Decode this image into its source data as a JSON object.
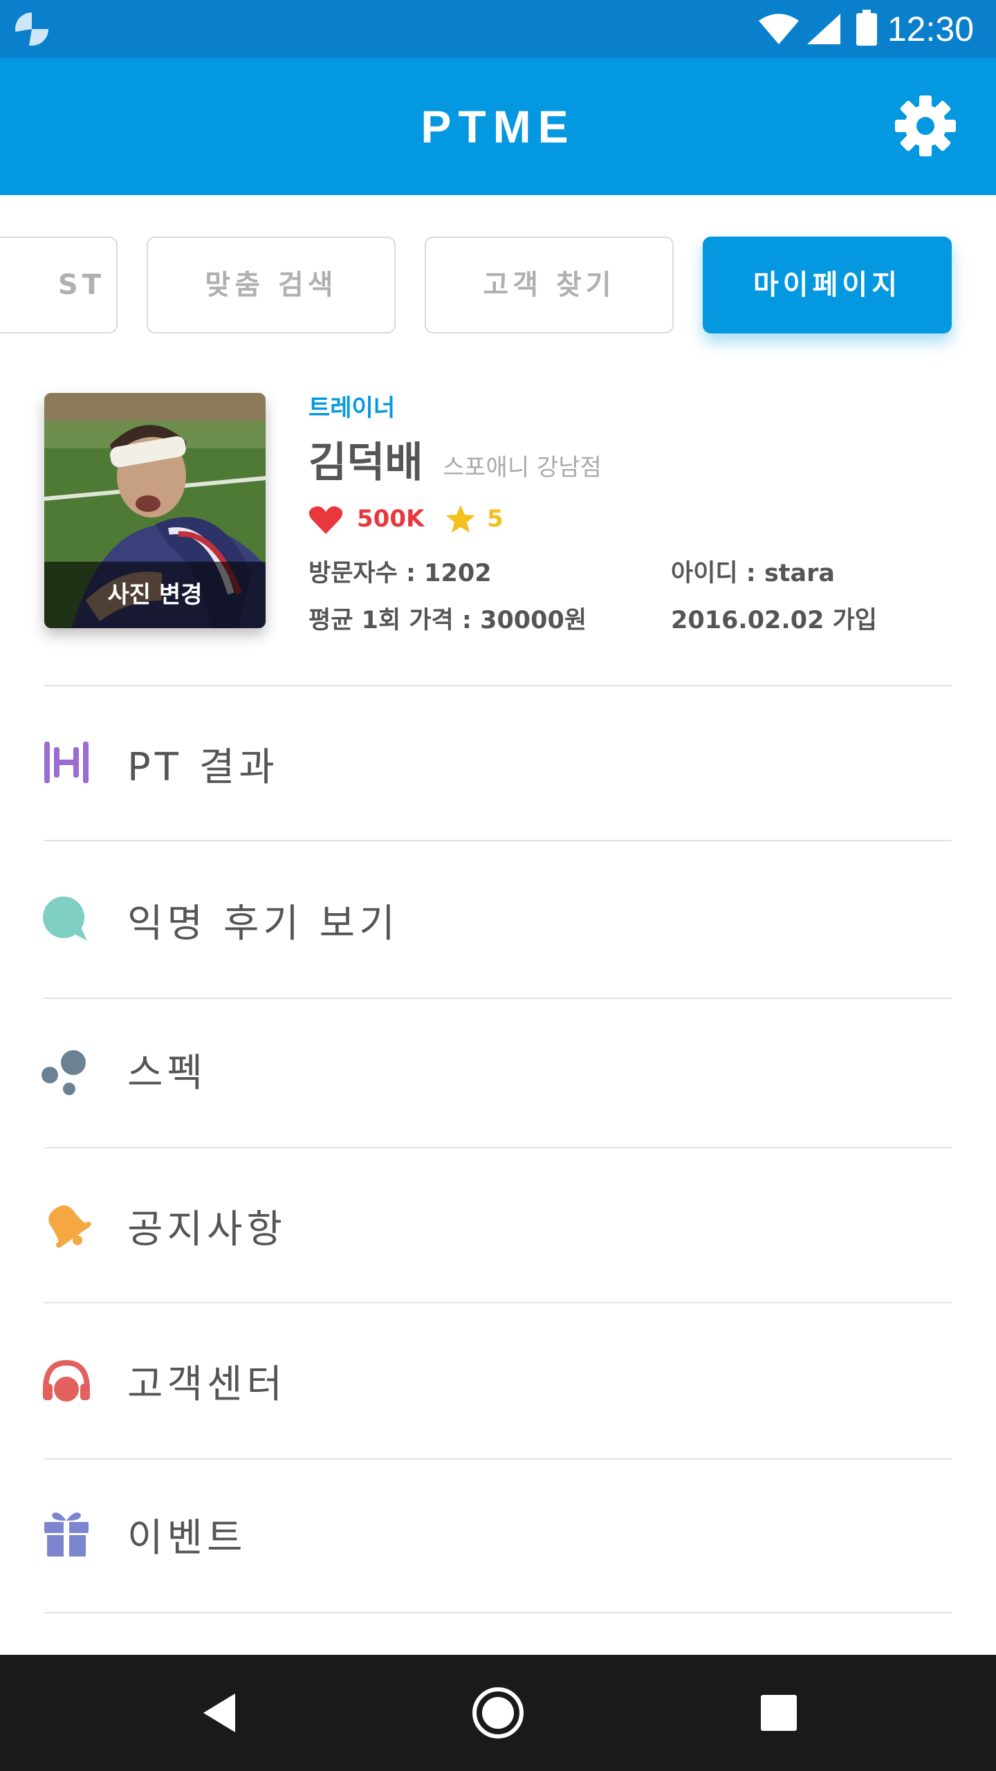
{
  "status_bar": {
    "time": "12:30"
  },
  "header": {
    "title": "PTME"
  },
  "tabs": [
    {
      "label": "ST"
    },
    {
      "label": "맞춤 검색"
    },
    {
      "label": "고객 찾기"
    },
    {
      "label": "마이페이지"
    }
  ],
  "profile": {
    "photo_change_label": "사진 변경",
    "role": "트레이너",
    "name": "김덕배",
    "gym": "스포애니 강남점",
    "likes": "500K",
    "rating": "5",
    "visitors": "방문자수 : 1202",
    "user_id": "아이디 : stara",
    "avg_price": "평균 1회 가격 : 30000원",
    "join_date": "2016.02.02 가입"
  },
  "menu": [
    {
      "label": "PT 결과",
      "icon": "dumbbell-icon",
      "color": "#9b6dd1"
    },
    {
      "label": "익명 후기 보기",
      "icon": "chat-bubble-icon",
      "color": "#7fcfc4"
    },
    {
      "label": "스펙",
      "icon": "bubbles-icon",
      "color": "#6a8294"
    },
    {
      "label": "공지사항",
      "icon": "bell-icon",
      "color": "#f5a742"
    },
    {
      "label": "고객센터",
      "icon": "headset-icon",
      "color": "#e2605e"
    },
    {
      "label": "이벤트",
      "icon": "gift-icon",
      "color": "#7b86cf"
    }
  ],
  "colors": {
    "accent": "#0498e0",
    "status_bar": "#0a7fcb",
    "heart": "#e8383d",
    "star": "#f3c01d"
  }
}
